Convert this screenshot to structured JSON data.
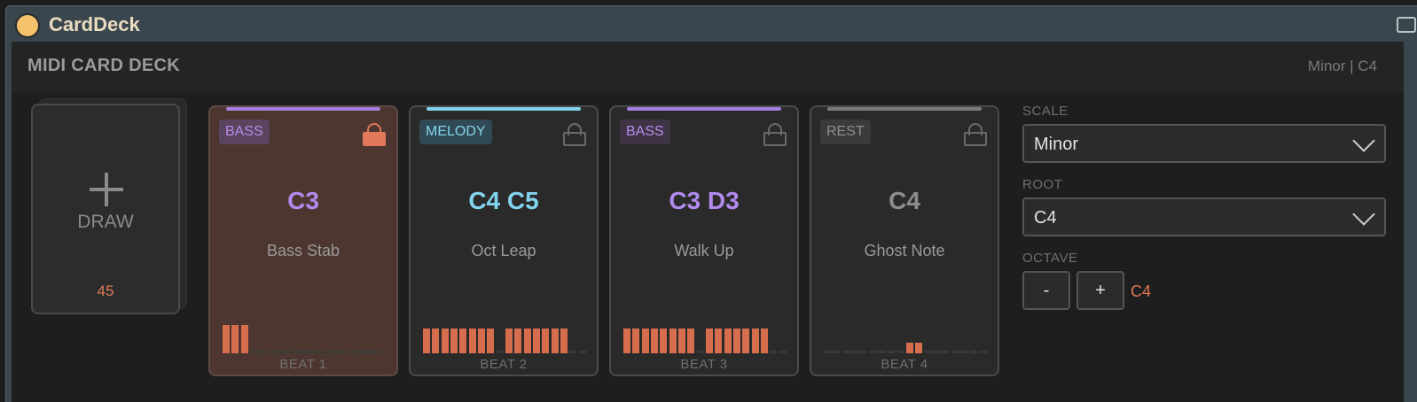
{
  "window": {
    "title": "CardDeck"
  },
  "header": {
    "title": "MIDI CARD DECK",
    "status": "Minor | C4"
  },
  "deck": {
    "draw_label": "DRAW",
    "count": "45"
  },
  "cards": [
    {
      "tag": "BASS",
      "tag_color": "#b98de8",
      "tag_bg": "#5a4460",
      "line_color": "#a47ee0",
      "notes": "C3",
      "notes_color": "#b18aed",
      "name": "Bass Stab",
      "beat": "BEAT 1",
      "locked": true,
      "selected": true,
      "steps": [
        1,
        1,
        1,
        0,
        0,
        0,
        0,
        0,
        0,
        0,
        0,
        0,
        0,
        0,
        0,
        0,
        0,
        0
      ]
    },
    {
      "tag": "MELODY",
      "tag_color": "#86d4ea",
      "tag_bg": "#2f4a54",
      "line_color": "#7fd3ea",
      "notes": "C4 C5",
      "notes_color": "#82d3ee",
      "name": "Oct Leap",
      "beat": "BEAT 2",
      "locked": false,
      "selected": false,
      "steps": [
        1,
        1,
        1,
        1,
        1,
        1,
        1,
        1,
        0,
        1,
        1,
        1,
        1,
        1,
        1,
        1,
        0,
        0
      ]
    },
    {
      "tag": "BASS",
      "tag_color": "#b98de8",
      "tag_bg": "#3e3446",
      "line_color": "#a47ee0",
      "notes": "C3 D3",
      "notes_color": "#b18aed",
      "name": "Walk Up",
      "beat": "BEAT 3",
      "locked": false,
      "selected": false,
      "steps": [
        1,
        1,
        1,
        1,
        1,
        1,
        1,
        1,
        0,
        1,
        1,
        1,
        1,
        1,
        1,
        1,
        0,
        0
      ]
    },
    {
      "tag": "REST",
      "tag_color": "#8f8f8f",
      "tag_bg": "#3a3a3a",
      "line_color": "#7a7a7a",
      "notes": "C4",
      "notes_color": "#8d8d8d",
      "name": "Ghost Note",
      "beat": "BEAT 4",
      "locked": false,
      "selected": false,
      "steps": [
        0,
        0,
        0,
        0,
        0,
        0,
        0,
        0,
        0,
        1,
        1,
        0,
        0,
        0,
        0,
        0,
        0,
        0
      ]
    }
  ],
  "side": {
    "scale_label": "SCALE",
    "scale_value": "Minor",
    "root_label": "ROOT",
    "root_value": "C4",
    "octave_label": "OCTAVE",
    "minus": "-",
    "plus": "+",
    "octave_value": "C4"
  }
}
